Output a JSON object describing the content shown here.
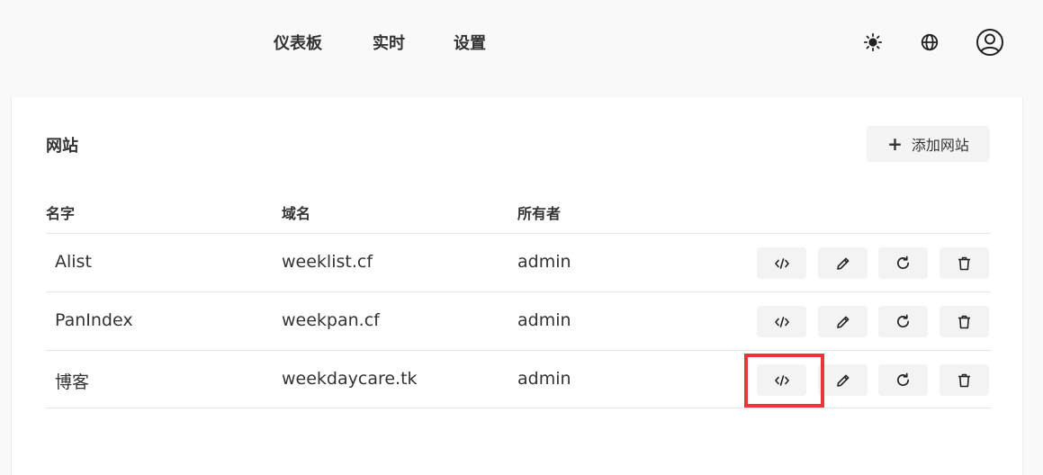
{
  "nav": {
    "items": [
      {
        "label": "仪表板"
      },
      {
        "label": "实时"
      },
      {
        "label": "设置"
      }
    ],
    "icons": [
      "sun-icon",
      "globe-icon",
      "user-circle-icon"
    ]
  },
  "section": {
    "title": "网站",
    "add_button_label": "添加网站"
  },
  "table": {
    "headers": [
      "名字",
      "域名",
      "所有者"
    ],
    "rows": [
      {
        "name": "Alist",
        "domain": "weeklist.cf",
        "owner": "admin"
      },
      {
        "name": "PanIndex",
        "domain": "weekpan.cf",
        "owner": "admin"
      },
      {
        "name": "博客",
        "domain": "weekdaycare.tk",
        "owner": "admin"
      }
    ],
    "row_actions": [
      "code-icon",
      "pencil-icon",
      "refresh-icon",
      "trash-icon"
    ]
  },
  "colors": {
    "background": "#f9f9f9",
    "card": "#ffffff",
    "button_bg": "#f3f3f3",
    "highlight": "#e8373a",
    "text": "#333333"
  }
}
